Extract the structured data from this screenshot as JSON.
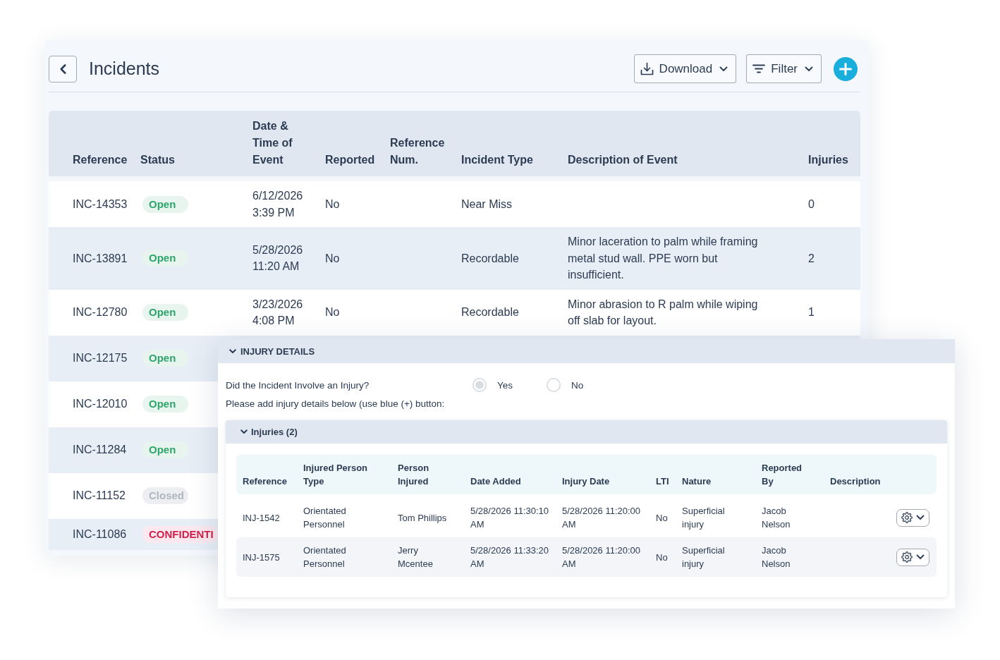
{
  "header": {
    "title": "Incidents",
    "buttons": [
      {
        "label": "Download",
        "kind": "download"
      },
      {
        "label": "Filter",
        "kind": "filter"
      }
    ]
  },
  "table": {
    "columns": [
      "Reference",
      "Status",
      "Date & Time of Event",
      "Reported",
      "Reference Num.",
      "Incident Type",
      "Description of Event",
      "Injuries"
    ],
    "rows": [
      {
        "reference": "INC-14353",
        "status": {
          "label": "Open",
          "kind": "open"
        },
        "date_time": "6/12/2026 3:39 PM",
        "reported": "No",
        "incident_type": "Near Miss",
        "injuries": "0"
      },
      {
        "reference": "INC-13891",
        "status": {
          "label": "Open",
          "kind": "open"
        },
        "date_time": "5/28/2026 11:20 AM",
        "reported": "No",
        "incident_type": "Recordable",
        "description": "Minor laceration to palm while framing metal stud wall. PPE worn but insufficient.",
        "injuries": "2"
      },
      {
        "reference": "INC-12780",
        "status": {
          "label": "Open",
          "kind": "open"
        },
        "date_time": "3/23/2026 4:08 PM",
        "reported": "No",
        "incident_type": "Recordable",
        "description": "Minor abrasion to R palm while wiping off slab for layout.",
        "injuries": "1"
      },
      {
        "reference": "INC-12175",
        "status": {
          "label": "Open",
          "kind": "open"
        }
      },
      {
        "reference": "INC-12010",
        "status": {
          "label": "Open",
          "kind": "open"
        }
      },
      {
        "reference": "INC-11284",
        "status": {
          "label": "Open",
          "kind": "open"
        }
      },
      {
        "reference": "INC-11152",
        "status": {
          "label": "Closed",
          "kind": "closed"
        }
      },
      {
        "reference": "INC-11086",
        "status": {
          "label": "CONFIDENTI",
          "kind": "confidential"
        }
      }
    ]
  },
  "injury_details": {
    "title": "INJURY DETAILS",
    "expanded": true,
    "question": "Did the Incident Involve an Injury?",
    "answer": {
      "disabled": true,
      "options": [
        {
          "label": "Yes",
          "selected": true
        },
        {
          "label": "No",
          "selected": false
        }
      ]
    },
    "instruction": "Please add injury details below (use blue (+) button:",
    "injuries": {
      "title": "Injuries (2)",
      "expanded": true,
      "columns": [
        "Reference",
        "Injured Person Type",
        "Person Injured",
        "Date Added",
        "Injury Date",
        "LTI",
        "Nature",
        "Reported By",
        "Description"
      ],
      "rows": [
        {
          "reference": "INJ-1542",
          "person_type": "Orientated Personnel",
          "person_injured": "Tom Phillips",
          "date_added": "5/28/2026 11:30:10 AM",
          "injury_date": "5/28/2026 11:20:00 AM",
          "lti": "No",
          "nature": "Superficial injury",
          "reported_by": "Jacob Nelson"
        },
        {
          "reference": "INJ-1575",
          "person_type": "Orientated Personnel",
          "person_injured": "Jerry Mcentee",
          "date_added": "5/28/2026 11:33:20 AM",
          "injury_date": "5/28/2026 11:20:00 AM",
          "lti": "No",
          "nature": "Superficial injury",
          "reported_by": "Jacob Nelson"
        }
      ]
    }
  }
}
